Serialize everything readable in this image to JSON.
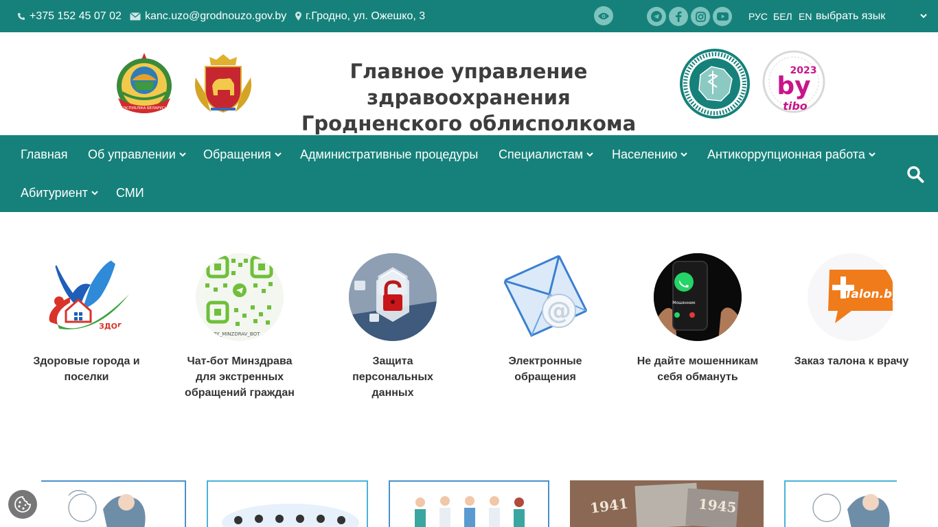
{
  "topbar": {
    "phone": "+375 152 45 07 02",
    "email": "kanc.uzo@grodnouzo.gov.by",
    "address": "г.Гродно, ул. Ожешко, 3",
    "lang_ru": "РУС",
    "lang_be": "БЕЛ",
    "lang_en": "EN",
    "lang_select": "выбрать язык"
  },
  "header": {
    "title_line1": "Главное управление здравоохранения",
    "title_line2": "Гродненского облисполкома",
    "tibo_year": "2023",
    "tibo_by": "by",
    "tibo_name": "tibo",
    "emblem_text": "РЭСПУБЛІКА БЕЛАРУСЬ"
  },
  "nav": {
    "items": [
      {
        "label": "Главная"
      },
      {
        "label": "Об управлении"
      },
      {
        "label": "Обращения"
      },
      {
        "label": "Административные процедуры"
      },
      {
        "label": "Специалистам"
      },
      {
        "label": "Населению"
      },
      {
        "label": "Антикоррупционная работа"
      },
      {
        "label": "Абитуриент"
      },
      {
        "label": "СМИ"
      }
    ]
  },
  "quick_links": [
    {
      "label": "Здоровые города и поселки",
      "image_text": "ЗДОРО"
    },
    {
      "label": "Чат-бот Минздрава для экстренных обращений граждан",
      "image_text": "BY_MINZDRAV_BOT"
    },
    {
      "label": "Защита персональных данных"
    },
    {
      "label": "Электронные обращения"
    },
    {
      "label": "Не дайте мошенникам себя обмануть",
      "image_text": "Мошенник"
    },
    {
      "label": "Заказ талона к врачу",
      "image_text": "Talon.by"
    }
  ],
  "banners": [
    {
      "image_text": ""
    },
    {
      "image_text": ""
    },
    {
      "image_text": ""
    },
    {
      "year_left": "1941",
      "year_right": "1945"
    },
    {
      "image_text": ""
    }
  ],
  "colors": {
    "primary": "#16817a",
    "icon_bg": "#7dc3be",
    "text": "#333333"
  }
}
